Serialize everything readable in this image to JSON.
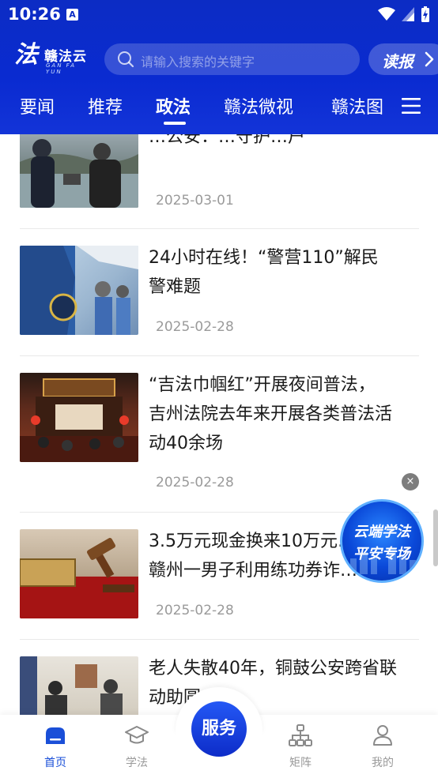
{
  "status": {
    "time": "10:26",
    "app_badge": "A"
  },
  "header": {
    "logo_mark": "法",
    "logo_text": "赣法云",
    "logo_sub": "GAN FA YUN",
    "search_placeholder": "请输入搜索的关键字",
    "read_paper_label": "读报"
  },
  "tabs": [
    {
      "label": "要闻",
      "active": false
    },
    {
      "label": "推荐",
      "active": false
    },
    {
      "label": "政法",
      "active": true
    },
    {
      "label": "赣法微视",
      "active": false
    },
    {
      "label": "赣法图",
      "active": false
    }
  ],
  "news": [
    {
      "title_lines": [
        "…公安：…守护…户"
      ],
      "title": "井冈公安：护…守护…户",
      "date": "2025-03-01"
    },
    {
      "title_lines": [
        "24小时在线！“警营110”解民",
        "警难题"
      ],
      "date": "2025-02-28"
    },
    {
      "title_lines": [
        "“吉法巾帼红”开展夜间普法，",
        "吉州法院去年来开展各类普法活",
        "动40余场"
      ],
      "date": "2025-02-28"
    },
    {
      "title_lines": [
        "3.5万元现金换来10万元…",
        "赣州一男子利用练功券诈…"
      ],
      "date": "2025-02-28"
    },
    {
      "title_lines": [
        "老人失散40年，铜鼓公安跨省联",
        "动助圆…"
      ],
      "date": ""
    }
  ],
  "promo": {
    "line1": "云端学法",
    "line2": "平安专场",
    "close_label": "×"
  },
  "bottom_nav": {
    "home": "首页",
    "study": "学法",
    "service": "服务",
    "matrix": "矩阵",
    "mine": "我的"
  },
  "colors": {
    "brand_blue": "#0c2cc4",
    "active_nav": "#1a4fd8",
    "date_gray": "#9a9a9a"
  }
}
